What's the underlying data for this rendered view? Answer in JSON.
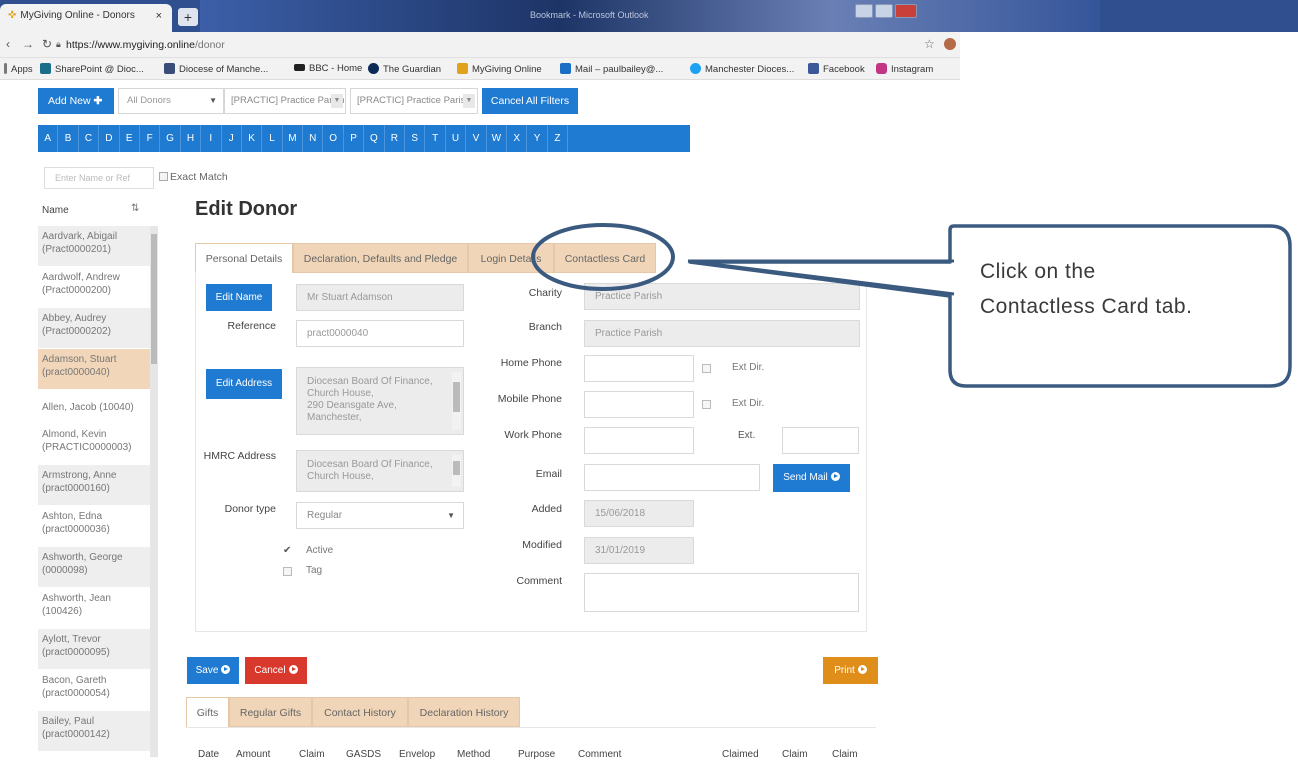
{
  "browser": {
    "tab_title": "MyGiving Online - Donors",
    "tab_close": "×",
    "new_tab": "+",
    "window_title": "Bookmark - Microsoft Outlook",
    "url_host": "https://www.mygiving.online",
    "url_path": "/donor",
    "bookmarks": [
      "Apps",
      "SharePoint @ Dioc...",
      "Diocese of Manche...",
      "BBC - Home",
      "The Guardian",
      "MyGiving Online",
      "Mail – paulbailey@...",
      "Manchester Dioces...",
      "Facebook",
      "Instagram"
    ]
  },
  "toolbar": {
    "add_new": "Add New",
    "donor_filter": "All Donors",
    "parish_filter_1": "[PRACTIC] Practice Parish",
    "parish_filter_2": "[PRACTIC] Practice Parish",
    "cancel_filters": "Cancel All Filters"
  },
  "alphabet": [
    "A",
    "B",
    "C",
    "D",
    "E",
    "F",
    "G",
    "H",
    "I",
    "J",
    "K",
    "L",
    "M",
    "N",
    "O",
    "P",
    "Q",
    "R",
    "S",
    "T",
    "U",
    "V",
    "W",
    "X",
    "Y",
    "Z"
  ],
  "search": {
    "placeholder": "Enter Name or Ref",
    "exact_match": "Exact Match"
  },
  "list": {
    "header": "Name",
    "items": [
      {
        "name": "Aardvark, Abigail",
        "ref": "(Pract0000201)"
      },
      {
        "name": "Aardwolf, Andrew",
        "ref": "(Pract0000200)"
      },
      {
        "name": "Abbey, Audrey",
        "ref": "(Pract0000202)"
      },
      {
        "name": "Adamson, Stuart",
        "ref": "(pract0000040)"
      },
      {
        "name": "Allen, Jacob (10040)",
        "ref": ""
      },
      {
        "name": "Almond, Kevin",
        "ref": "(PRACTIC0000003)"
      },
      {
        "name": "Armstrong, Anne",
        "ref": "(pract0000160)"
      },
      {
        "name": "Ashton, Edna",
        "ref": "(pract0000036)"
      },
      {
        "name": "Ashworth, George",
        "ref": "(0000098)"
      },
      {
        "name": "Ashworth, Jean",
        "ref": "(100426)"
      },
      {
        "name": "Aylott, Trevor",
        "ref": "(pract0000095)"
      },
      {
        "name": "Bacon, Gareth",
        "ref": "(pract0000054)"
      },
      {
        "name": "Bailey, Paul",
        "ref": "(pract0000142)"
      }
    ]
  },
  "form": {
    "title": "Edit Donor",
    "tabs": [
      "Personal Details",
      "Declaration, Defaults and Pledge",
      "Login Details",
      "Contactless Card"
    ],
    "edit_name": "Edit Name",
    "name_value": "Mr Stuart Adamson",
    "reference_label": "Reference",
    "reference_value": "pract0000040",
    "edit_address": "Edit Address",
    "address_lines": [
      "Diocesan Board Of Finance,",
      "Church House,",
      "290 Deansgate Ave,",
      "Manchester,"
    ],
    "hmrc_label": "HMRC Address",
    "hmrc_lines": [
      "Diocesan Board Of Finance,",
      "Church House,"
    ],
    "donor_type_label": "Donor type",
    "donor_type_value": "Regular",
    "active_label": "Active",
    "tag_label": "Tag",
    "charity_label": "Charity",
    "charity_value": "Practice Parish",
    "branch_label": "Branch",
    "branch_value": "Practice Parish",
    "home_phone_label": "Home Phone",
    "mobile_phone_label": "Mobile Phone",
    "work_phone_label": "Work Phone",
    "ext_dir": "Ext Dir.",
    "ext": "Ext.",
    "email_label": "Email",
    "send_mail": "Send Mail",
    "added_label": "Added",
    "added_value": "15/06/2018",
    "modified_label": "Modified",
    "modified_value": "31/01/2019",
    "comment_label": "Comment"
  },
  "actions": {
    "save": "Save",
    "cancel": "Cancel",
    "print": "Print"
  },
  "bottom_tabs": [
    "Gifts",
    "Regular Gifts",
    "Contact History",
    "Declaration History"
  ],
  "gift_columns": [
    "Date",
    "Amount",
    "Claim",
    "GASDS",
    "Envelop",
    "Method",
    "Purpose",
    "Comment",
    "Claimed",
    "Claim",
    "Claim"
  ],
  "callout": {
    "text": "Click on the Contactless Card tab."
  },
  "colors": {
    "primary": "#1f7ad1",
    "danger": "#d9382c",
    "warning": "#e08e1a",
    "tab_off": "#f0d5b8",
    "callout_border": "#3b5a80"
  }
}
